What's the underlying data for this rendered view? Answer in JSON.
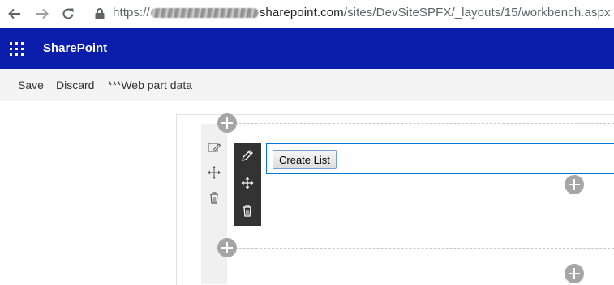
{
  "browser": {
    "url_scheme": "https://",
    "url_host_visible": "sharepoint.com",
    "url_path": "/sites/DevSiteSPFX/_layouts/15/workbench.aspx"
  },
  "suite_bar": {
    "title": "SharePoint",
    "bg_color": "#0a1dab"
  },
  "command_bar": {
    "save_label": "Save",
    "discard_label": "Discard",
    "web_part_data_label": "***Web part data"
  },
  "web_part": {
    "button_label": "Create List",
    "accent_color": "#0078d4",
    "toolbar_icons": [
      "edit-icon",
      "move-icon",
      "delete-icon"
    ]
  },
  "section_toolbar": {
    "icons": [
      "edit-section-icon",
      "move-section-icon",
      "delete-section-icon"
    ]
  }
}
